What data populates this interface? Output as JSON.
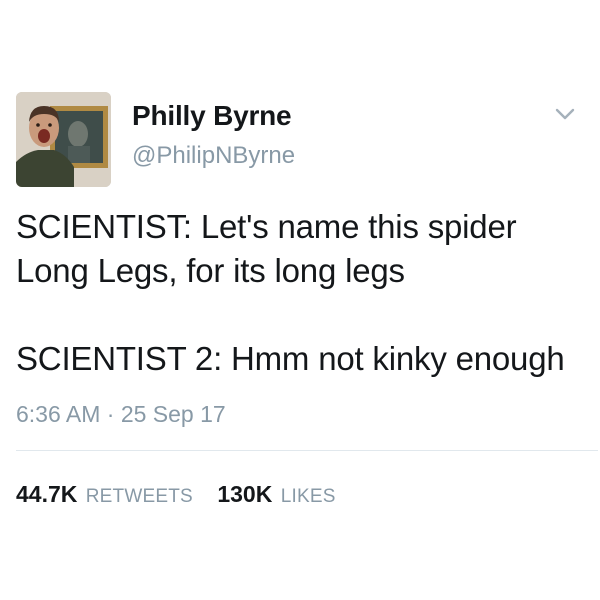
{
  "user": {
    "display_name": "Philly Byrne",
    "handle": "@PhilipNByrne",
    "avatar_icon": "user-avatar-photo"
  },
  "tweet": {
    "text": "SCIENTIST: Let's name this spider\nLong Legs, for its long legs\n\nSCIENTIST 2: Hmm not kinky enough",
    "timestamp": "6:36 AM · 25 Sep 17"
  },
  "stats": {
    "retweets_count": "44.7K",
    "retweets_label": "RETWEETS",
    "likes_count": "130K",
    "likes_label": "LIKES"
  },
  "icons": {
    "menu": "chevron-down-icon"
  },
  "colors": {
    "primary_text": "#14171a",
    "secondary_text": "#8899a6",
    "divider": "#e1e8ed",
    "background": "#ffffff"
  }
}
